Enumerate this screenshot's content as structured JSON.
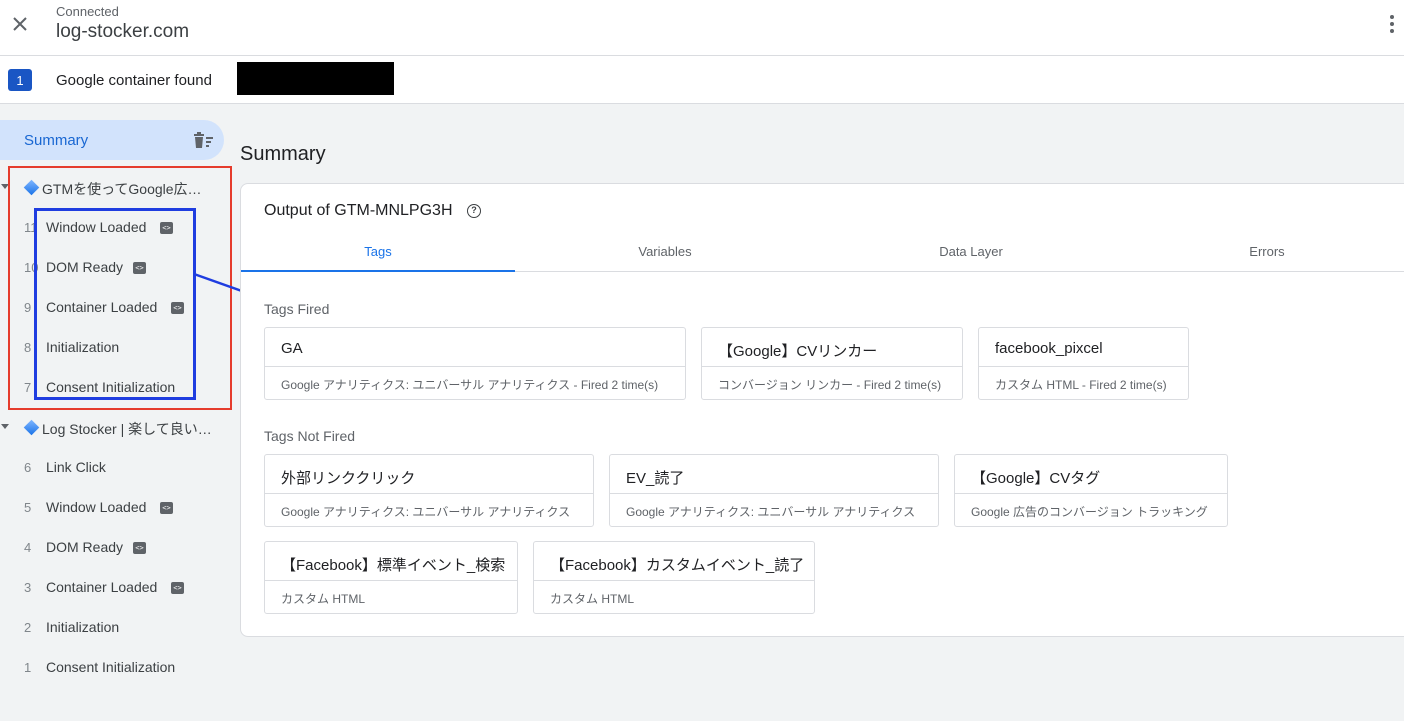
{
  "header": {
    "status": "Connected",
    "site": "log-stocker.com",
    "container_count": "1",
    "container_found": "Google container found"
  },
  "sidebar": {
    "summary_label": "Summary",
    "groups": [
      {
        "label": "GTMを使ってGoogle広…",
        "events": [
          {
            "num": "11",
            "label": "Window Loaded",
            "code": true
          },
          {
            "num": "10",
            "label": "DOM Ready",
            "code": true
          },
          {
            "num": "9",
            "label": "Container Loaded",
            "code": true
          },
          {
            "num": "8",
            "label": "Initialization",
            "code": false
          },
          {
            "num": "7",
            "label": "Consent Initialization",
            "code": false
          }
        ]
      },
      {
        "label": "Log Stocker | 楽して良い…",
        "events": [
          {
            "num": "6",
            "label": "Link Click",
            "code": false
          },
          {
            "num": "5",
            "label": "Window Loaded",
            "code": true
          },
          {
            "num": "4",
            "label": "DOM Ready",
            "code": true
          },
          {
            "num": "3",
            "label": "Container Loaded",
            "code": true
          },
          {
            "num": "2",
            "label": "Initialization",
            "code": false
          },
          {
            "num": "1",
            "label": "Consent Initialization",
            "code": false
          }
        ]
      }
    ]
  },
  "main": {
    "title": "Summary",
    "output_title": "Output of GTM-MNLPG3H",
    "tabs": [
      "Tags",
      "Variables",
      "Data Layer",
      "Errors"
    ],
    "active_tab": "Tags",
    "tags_fired_label": "Tags Fired",
    "tags_not_fired_label": "Tags Not Fired",
    "tags_fired": [
      {
        "name": "GA",
        "sub": "Google アナリティクス: ユニバーサル アナリティクス - Fired 2 time(s)"
      },
      {
        "name": "【Google】CVリンカー",
        "sub": "コンバージョン リンカー - Fired 2 time(s)"
      },
      {
        "name": "facebook_pixcel",
        "sub": "カスタム HTML - Fired 2 time(s)"
      }
    ],
    "tags_not_fired": [
      {
        "name": "外部リンククリック",
        "sub": "Google アナリティクス: ユニバーサル アナリティクス"
      },
      {
        "name": "EV_読了",
        "sub": "Google アナリティクス: ユニバーサル アナリティクス"
      },
      {
        "name": "【Google】CVタグ",
        "sub": "Google 広告のコンバージョン トラッキング"
      },
      {
        "name": "【Facebook】標準イベント_検索",
        "sub": "カスタム HTML"
      },
      {
        "name": "【Facebook】カスタムイベント_読了",
        "sub": "カスタム HTML"
      }
    ]
  },
  "colors": {
    "accent": "#1a73e8",
    "annotation_red": "#e53b2c",
    "annotation_blue": "#1f3de0"
  }
}
